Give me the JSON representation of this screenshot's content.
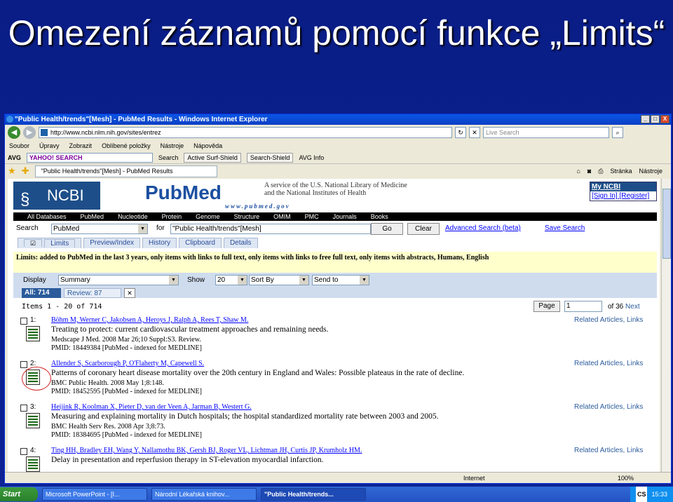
{
  "slide_title": "Omezení záznamů pomocí funkce „Limits“",
  "window": {
    "title": "\"Public Health/trends\"[Mesh] - PubMed Results - Windows Internet Explorer",
    "controls": [
      "_",
      "□",
      "X"
    ]
  },
  "address": {
    "url": "http://www.ncbi.nlm.nih.gov/sites/entrez",
    "search_placeholder": "Live Search"
  },
  "menu": [
    "Soubor",
    "Úpravy",
    "Zobrazit",
    "Oblíbené položky",
    "Nástroje",
    "Nápověda"
  ],
  "toolbar2": {
    "avg": "AVG",
    "yahoo": "YAHOO! SEARCH",
    "search": "Search",
    "active_shield": "Active Surf-Shield",
    "search_shield": "Search-Shield",
    "avg_info": "AVG Info"
  },
  "tab_title": "\"Public Health/trends\"[Mesh] - PubMed Results",
  "tab_tools": {
    "page": "Stránka",
    "tools": "Nástroje"
  },
  "ncbi": {
    "logo": "NCBI",
    "pubmed": "PubMed",
    "pubmed_url": "www.pubmed.gov",
    "service_line1": "A service of the U.S. National Library of Medicine",
    "service_line2": "and the National Institutes of Health",
    "myncbi_title": "My NCBI",
    "myncbi_links": "[Sign In] [Register]"
  },
  "db_bar": [
    "All Databases",
    "PubMed",
    "Nucleotide",
    "Protein",
    "Genome",
    "Structure",
    "OMIM",
    "PMC",
    "Journals",
    "Books"
  ],
  "search": {
    "label": "Search",
    "db": "PubMed",
    "for_label": "for",
    "query": "\"Public Health/trends\"[Mesh]",
    "go": "Go",
    "clear": "Clear",
    "advanced": "Advanced Search (beta)",
    "save": "Save Search"
  },
  "subtabs": [
    "Limits",
    "Preview/Index",
    "History",
    "Clipboard",
    "Details"
  ],
  "limits_text": "Limits: added to PubMed in the last 3 years, only items with links to full text, only items with links to free full text, only items with abstracts, Humans, English",
  "display": {
    "label": "Display",
    "format": "Summary",
    "show_label": "Show",
    "show": "20",
    "sort": "Sort By",
    "send": "Send to"
  },
  "results_tabs": {
    "all": "All: 714",
    "review": "Review: 87"
  },
  "items": {
    "range": "Items 1 - 20 of 714",
    "page_btn": "Page",
    "page_value": "1",
    "of": "of 36",
    "next": "Next"
  },
  "results": [
    {
      "num": "1:",
      "authors": "Böhm M, Werner C, Jakobsen A, Heroys J, Ralph A, Rees T, Shaw M.",
      "title": "Treating to protect: current cardiovascular treatment approaches and remaining needs.",
      "source": "Medscape J Med. 2008 Mar 26;10 Suppl:S3. Review.",
      "pmid": "PMID: 18449384 [PubMed - indexed for MEDLINE]",
      "related": "Related Articles, Links"
    },
    {
      "num": "2:",
      "authors": "Allender S, Scarborough P, O'Flaherty M, Capewell S.",
      "title": "Patterns of coronary heart disease mortality over the 20th century in England and Wales: Possible plateaus in the rate of decline.",
      "source": "BMC Public Health. 2008 May 1;8:148.",
      "pmid": "PMID: 18452595 [PubMed - indexed for MEDLINE]",
      "related": "Related Articles, Links"
    },
    {
      "num": "3:",
      "authors": "Heijink R, Koolman X, Pieter D, van der Veen A, Jarman B, Westert G.",
      "title": "Measuring and explaining mortality in Dutch hospitals; the hospital standardized mortality rate between 2003 and 2005.",
      "source": "BMC Health Serv Res. 2008 Apr 3;8:73.",
      "pmid": "PMID: 18384695 [PubMed - indexed for MEDLINE]",
      "related": "Related Articles, Links"
    },
    {
      "num": "4:",
      "authors": "Ting HH, Bradley EH, Wang Y, Nallamothu BK, Gersh BJ, Roger VL, Lichtman JH, Curtis JP, Krumholz HM.",
      "title": "Delay in presentation and reperfusion therapy in ST-elevation myocardial infarction.",
      "source": "",
      "pmid": "",
      "related": "Related Articles, Links"
    }
  ],
  "status": {
    "zone": "Internet",
    "zoom": "100%"
  },
  "taskbar": {
    "start": "Start",
    "items": [
      "Microsoft PowerPoint - [I...",
      "Národní Lékařská knihov...",
      "\"Public Health/trends..."
    ],
    "lang": "CS",
    "time": "15:33"
  }
}
